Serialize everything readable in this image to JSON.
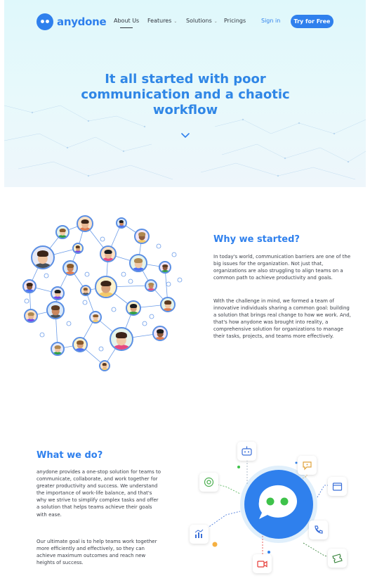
{
  "brand": {
    "name": "anydone",
    "color": "#2f80ed"
  },
  "nav": {
    "items": [
      {
        "label": "About Us",
        "active": true,
        "dropdown": false
      },
      {
        "label": "Features",
        "active": false,
        "dropdown": true
      },
      {
        "label": "Solutions",
        "active": false,
        "dropdown": true
      },
      {
        "label": "Pricings",
        "active": false,
        "dropdown": false
      }
    ],
    "signin": "Sign in",
    "cta": "Try for Free"
  },
  "hero": {
    "title": "It all started with poor communication and a chaotic workflow",
    "scroll_icon": "chevron-down-icon"
  },
  "why": {
    "title": "Why we started?",
    "paragraphs": [
      "In today's world, communication barriers are one of the big issues for the organization. Not just that, organizations are also struggling to align teams on a common path to achieve productivity and goals.",
      "With the challenge in mind, we formed a team of innovative individuals sharing a common goal: building a solution that brings real change to how we work. And, that's how anydone was brought into reality, a comprehensive solution for organizations to manage their tasks, projects, and teams more effectively."
    ]
  },
  "what": {
    "title": "What we do?",
    "paragraphs": [
      "anydone provides a one-stop solution for teams to communicate, collaborate, and work together for greater productivity and success. We understand the importance of work-life balance, and that's why we strive to simplify complex tasks and offer a solution that helps teams achieve their goals with ease.",
      "Our ultimate goal is to help teams work together more efficiently and effectively, so they can achieve maximum outcomes and reach new heights of success."
    ]
  },
  "hub_icons": [
    "robot-icon",
    "chat-bubble-icon",
    "calendar-icon",
    "phone-icon",
    "ticket-icon",
    "video-camera-icon",
    "analytics-chart-icon",
    "support-agent-icon"
  ]
}
